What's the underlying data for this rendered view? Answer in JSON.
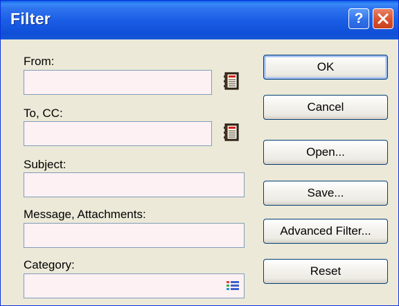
{
  "window": {
    "title": "Filter",
    "help_glyph": "?",
    "close_glyph": "close-icon"
  },
  "fields": {
    "from": {
      "label": "From:",
      "value": "",
      "icon": "address-book-icon"
    },
    "to_cc": {
      "label": "To, CC:",
      "value": "",
      "icon": "address-book-icon"
    },
    "subject": {
      "label": "Subject:",
      "value": ""
    },
    "message": {
      "label": "Message, Attachments:",
      "value": ""
    },
    "category": {
      "label": "Category:",
      "value": "",
      "icon": "category-list-icon"
    }
  },
  "buttons": {
    "ok": "OK",
    "cancel": "Cancel",
    "open": "Open...",
    "save": "Save...",
    "advanced": "Advanced Filter...",
    "reset": "Reset"
  },
  "colors": {
    "titlebar": "#1b5ee6",
    "field_bg": "#fdf1f3",
    "field_border": "#7f9db9",
    "dialog_bg": "#ece9d8"
  }
}
